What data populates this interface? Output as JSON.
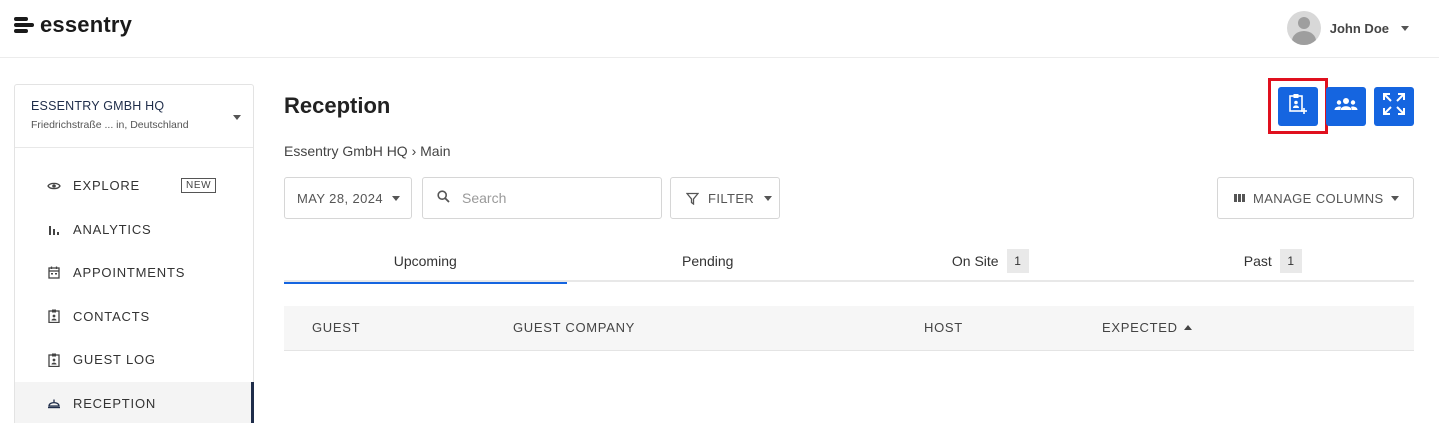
{
  "app": {
    "brand": "essentry"
  },
  "user": {
    "name": "John Doe"
  },
  "org": {
    "name": "ESSENTRY GMBH HQ",
    "address": "Friedrichstraße ... in, Deutschland"
  },
  "sidebar": {
    "items": [
      {
        "label": "EXPLORE",
        "icon": "eye-icon",
        "badge": "NEW"
      },
      {
        "label": "ANALYTICS",
        "icon": "bar-chart-icon"
      },
      {
        "label": "APPOINTMENTS",
        "icon": "calendar-icon"
      },
      {
        "label": "CONTACTS",
        "icon": "clipboard-person-icon"
      },
      {
        "label": "GUEST LOG",
        "icon": "clipboard-person-icon"
      },
      {
        "label": "RECEPTION",
        "icon": "service-bell-icon",
        "active": true
      }
    ]
  },
  "main": {
    "title": "Reception",
    "breadcrumb": "Essentry GmbH HQ › Main"
  },
  "actions": {
    "add_guest_icon": "clipboard-add-icon",
    "group_icon": "group-icon",
    "fullscreen_icon": "fullscreen-icon"
  },
  "toolbar": {
    "date": "MAY 28, 2024",
    "search_placeholder": "Search",
    "filter_label": "FILTER",
    "manage_columns_label": "MANAGE COLUMNS"
  },
  "tabs": [
    {
      "label": "Upcoming",
      "active": true
    },
    {
      "label": "Pending"
    },
    {
      "label": "On Site",
      "count": "1"
    },
    {
      "label": "Past",
      "count": "1"
    }
  ],
  "table": {
    "columns": [
      "GUEST",
      "GUEST COMPANY",
      "HOST",
      "EXPECTED"
    ]
  },
  "colors": {
    "accent": "#1565e0",
    "highlight": "#e0101e",
    "nav_active": "#1f2d4a"
  }
}
